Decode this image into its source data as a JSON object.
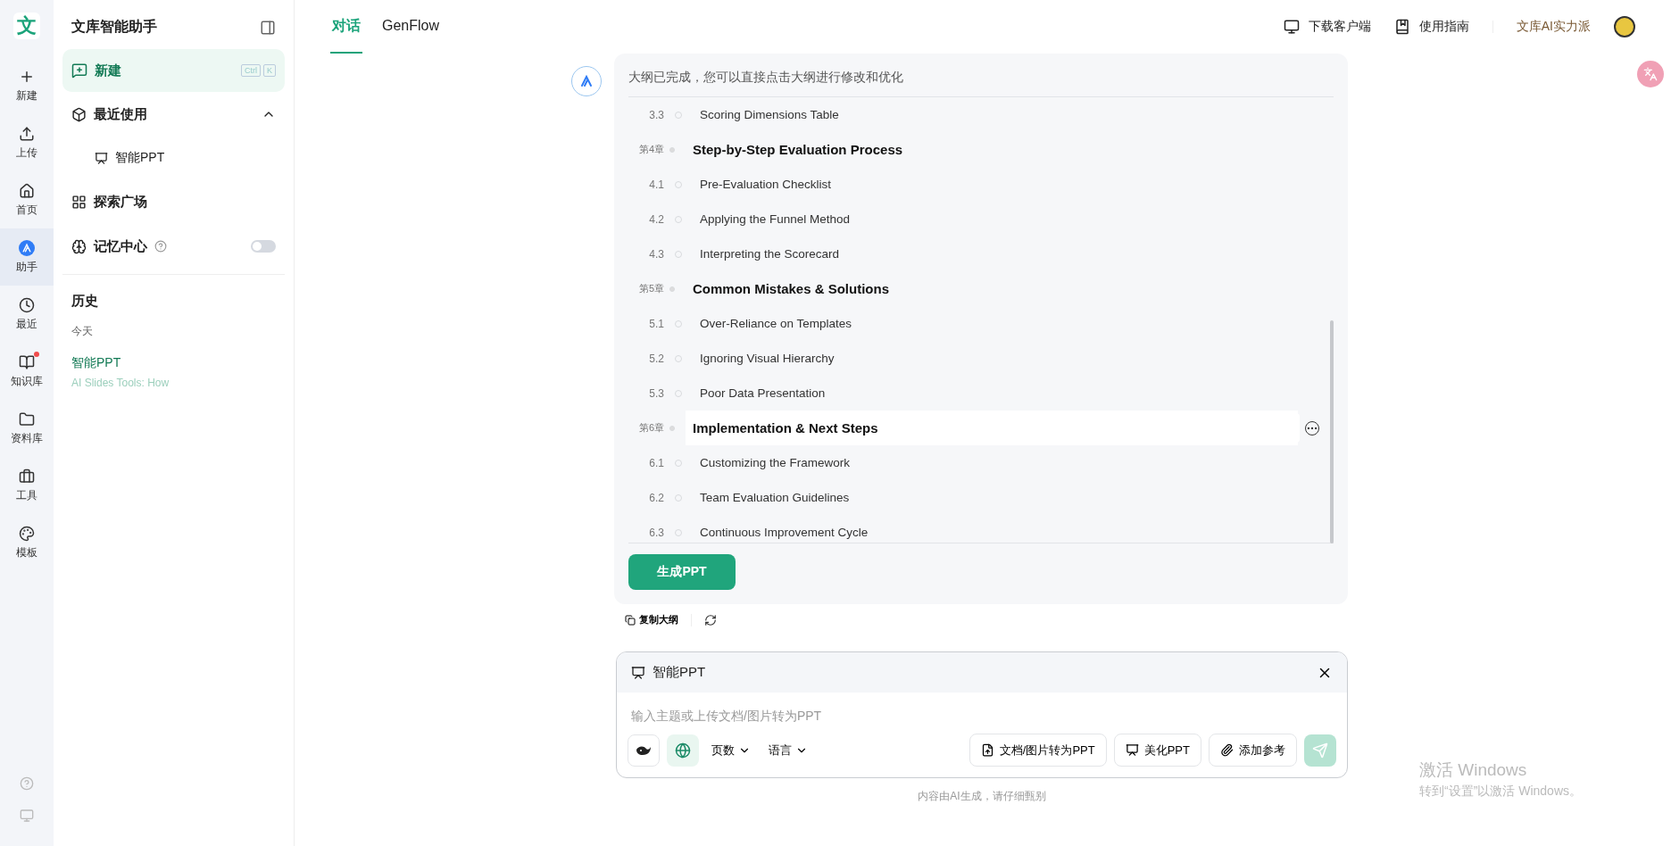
{
  "app": {
    "logo": "文",
    "title": "文库智能助手"
  },
  "rail": [
    {
      "label": "新建",
      "selected": false,
      "badge": false
    },
    {
      "label": "上传",
      "selected": false,
      "badge": false
    },
    {
      "label": "首页",
      "selected": false,
      "badge": false
    },
    {
      "label": "助手",
      "selected": true,
      "badge": false
    },
    {
      "label": "最近",
      "selected": false,
      "badge": false
    },
    {
      "label": "知识库",
      "selected": false,
      "badge": true
    },
    {
      "label": "资料库",
      "selected": false,
      "badge": false
    },
    {
      "label": "工具",
      "selected": false,
      "badge": false
    },
    {
      "label": "模板",
      "selected": false,
      "badge": false
    }
  ],
  "sidebar": {
    "new": {
      "label": "新建",
      "keys": [
        "Ctrl",
        "K"
      ]
    },
    "recent": {
      "label": "最近使用",
      "expanded": true,
      "children": [
        {
          "label": "智能PPT"
        }
      ]
    },
    "explore": {
      "label": "探索广场"
    },
    "memory": {
      "label": "记忆中心",
      "on": false
    },
    "history": {
      "title": "历史",
      "groups": [
        {
          "label": "今天",
          "items": [
            {
              "title": "智能PPT",
              "subtitle": "AI Slides Tools: How"
            }
          ]
        }
      ]
    }
  },
  "tabs": [
    {
      "label": "对话",
      "selected": true
    },
    {
      "label": "GenFlow",
      "selected": false
    }
  ],
  "header_links": [
    {
      "label": "下载客户端"
    },
    {
      "label": "使用指南"
    }
  ],
  "promo": "文库AI实力派",
  "message": {
    "intro": "大纲已完成，您可以直接点击大纲进行修改和优化",
    "outline": [
      {
        "kind": "section",
        "number": "3.3",
        "title": "Scoring Dimensions Table",
        "highlighted": false
      },
      {
        "kind": "chapter",
        "number": "第4章",
        "title": "Step-by-Step Evaluation Process",
        "highlighted": false,
        "children": [
          {
            "kind": "section",
            "number": "4.1",
            "title": "Pre-Evaluation Checklist",
            "highlighted": false
          },
          {
            "kind": "section",
            "number": "4.2",
            "title": "Applying the Funnel Method",
            "highlighted": false
          },
          {
            "kind": "section",
            "number": "4.3",
            "title": "Interpreting the Scorecard",
            "highlighted": false
          }
        ]
      },
      {
        "kind": "chapter",
        "number": "第5章",
        "title": "Common Mistakes & Solutions",
        "highlighted": false,
        "children": [
          {
            "kind": "section",
            "number": "5.1",
            "title": "Over-Reliance on Templates",
            "highlighted": false
          },
          {
            "kind": "section",
            "number": "5.2",
            "title": "Ignoring Visual Hierarchy",
            "highlighted": false
          },
          {
            "kind": "section",
            "number": "5.3",
            "title": "Poor Data Presentation",
            "highlighted": false
          }
        ]
      },
      {
        "kind": "chapter",
        "number": "第6章",
        "title": "Implementation & Next Steps",
        "highlighted": true,
        "children": [
          {
            "kind": "section",
            "number": "6.1",
            "title": "Customizing the Framework",
            "highlighted": false
          },
          {
            "kind": "section",
            "number": "6.2",
            "title": "Team Evaluation Guidelines",
            "highlighted": false
          },
          {
            "kind": "section",
            "number": "6.3",
            "title": "Continuous Improvement Cycle",
            "highlighted": false
          }
        ]
      }
    ],
    "generate_button": "生成PPT",
    "copy_outline": "复制大纲"
  },
  "composer": {
    "mode": "智能PPT",
    "placeholder": "输入主题或上传文档/图片转为PPT",
    "web_search": true,
    "dropdowns": [
      {
        "label": "页数"
      },
      {
        "label": "语言"
      }
    ],
    "actions": [
      {
        "label": "文档/图片转为PPT"
      },
      {
        "label": "美化PPT"
      },
      {
        "label": "添加参考"
      }
    ],
    "send_disabled": true
  },
  "disclaimer": "内容由AI生成，请仔细甄别",
  "os_notice": {
    "title": "激活 Windows",
    "text": "转到“设置”以激活 Windows。"
  }
}
